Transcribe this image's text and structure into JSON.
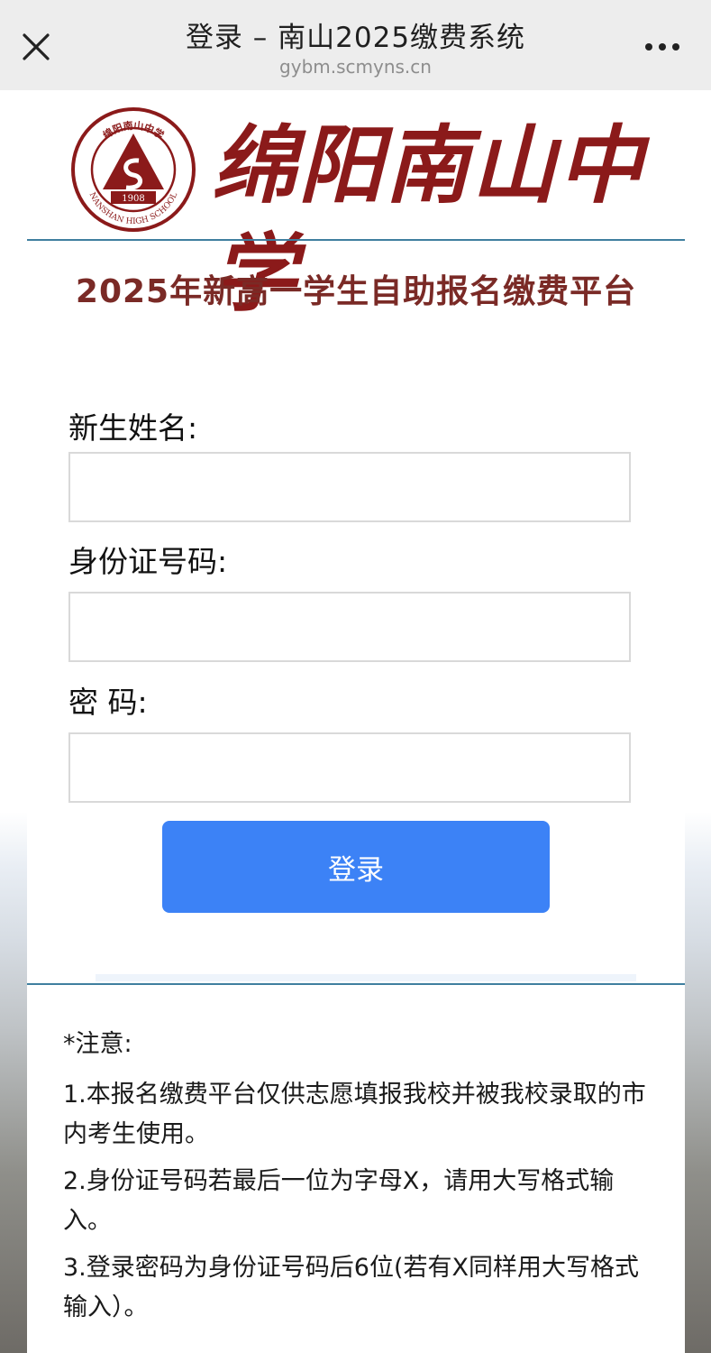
{
  "topbar": {
    "title": "登录 – 南山2025缴费系统",
    "url": "gybm.scmyns.cn",
    "close_icon": "close-icon",
    "more_icon": "more-horizontal-icon"
  },
  "header": {
    "school_name_calligraphy": "绵阳南山中学",
    "logo": {
      "icon": "school-seal-logo",
      "year": "1908",
      "english_name": "NANSHAN HIGH SCHOOL",
      "top_text": "绵阳南山中学"
    }
  },
  "platform_title": "2025年新高一学生自助报名缴费平台",
  "form": {
    "name_label": "新生姓名:",
    "name_value": "",
    "id_label": "身份证号码:",
    "id_value": "",
    "password_label": "密 码:",
    "password_value": "",
    "submit_label": "登录"
  },
  "notice": {
    "heading": "*注意:",
    "items": [
      "1.本报名缴费平台仅供志愿填报我校并被我校录取的市内考生使用。",
      "2.身份证号码若最后一位为字母X，请用大写格式输入。",
      "3.登录密码为身份证号码后6位(若有X同样用大写格式输入）。"
    ]
  },
  "colors": {
    "title_red": "#7a2a26",
    "calligraphy_red": "#8b1a1a",
    "button_blue": "#3c82f6",
    "rule_teal": "#3f7f9f",
    "topbar_gray": "#ededed"
  }
}
